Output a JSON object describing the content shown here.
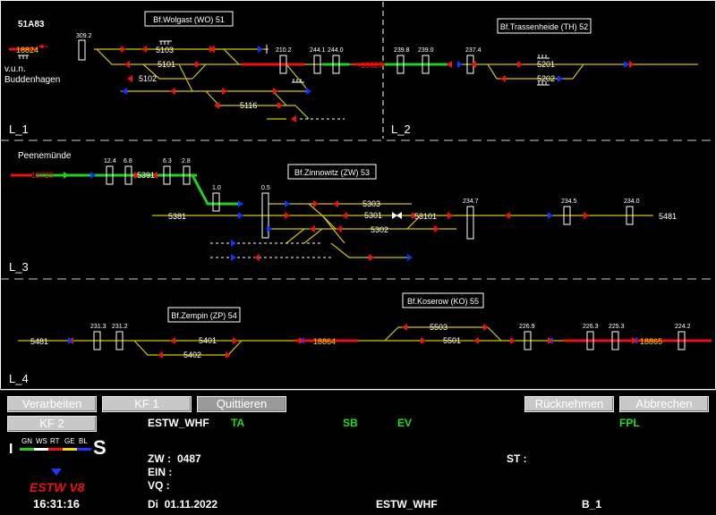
{
  "header": {
    "id": "51A83"
  },
  "stations": {
    "wolgast": "Bf.Wolgast (WO) 51",
    "trassenheide": "Bf.Trassenheide (TH) 52",
    "zinnowitz": "Bf.Zinnowitz (ZW) 53",
    "zempin": "Bf.Zempin (ZP) 54",
    "koserow": "Bf.Koserow (KO) 55"
  },
  "sections": {
    "l1": "L_1",
    "l2": "L_2",
    "l3": "L_3",
    "l4": "L_4"
  },
  "places": {
    "vun": "v.u.n.",
    "buddenhagen": "Buddenhagen",
    "peenemuende": "Peenemünde"
  },
  "trains": {
    "t18824": "18824",
    "t18827": "18827",
    "t18725": "18725",
    "t18864": "18864",
    "t18865": "18865"
  },
  "km": {
    "k309_2": "309.2",
    "k210_2": "210.2",
    "k244_1": "244.1",
    "k244_0": "244.0",
    "k239_8": "239.8",
    "k239_0": "239.0",
    "k237_4": "237.4",
    "k12_4": "12.4",
    "k6_8": "6.8",
    "k6_3": "6.3",
    "k2_8": "2.8",
    "k1_0": "1.0",
    "k0_5": "0.5",
    "k234_7": "234.7",
    "k234_5": "234.5",
    "k234_0": "234.0",
    "k231_3": "231.3",
    "k231_2": "231.2",
    "k226_9": "226.9",
    "k226_3": "226.3",
    "k225_3": "225.3",
    "k224_2": "224.2"
  },
  "signals": {
    "s5103": "5103",
    "s5101": "5101",
    "s5102": "5102",
    "s5116": "5116",
    "s5201": "5201",
    "s5202": "5202",
    "s5391": "5391",
    "s5381": "5381",
    "s5303": "5303",
    "s5301": "5301",
    "s53101": "53101",
    "s5302": "5302",
    "s5481a": "5481",
    "s5481b": "5481",
    "s5401": "5401",
    "s5402": "5402",
    "s5503": "5503",
    "s5501": "5501"
  },
  "buttons": {
    "verarbeiten": "Verarbeiten",
    "kf1": "KF 1",
    "quittieren": "Quittieren",
    "ruecknehmen": "Rücknehmen",
    "abbrechen": "Abbrechen",
    "kf2": "KF 2"
  },
  "status": {
    "estw_whf": "ESTW_WHF",
    "ta": "TA",
    "sb": "SB",
    "ev": "EV",
    "fpl": "FPL",
    "zw_label": "ZW :",
    "zw_value": "0487",
    "ein": "EIN :",
    "vq": "VQ :",
    "st": "ST :",
    "date": "Di  01.11.2022",
    "estw_bottom": "ESTW_WHF",
    "b1": "B_1",
    "time": "16:31:16"
  },
  "legend": {
    "i": "I",
    "s": "S",
    "gn": "GN",
    "ws": "WS",
    "rt": "RT",
    "ge": "GE",
    "bl": "BL",
    "colors": {
      "gn": "#22cc22",
      "ws": "#ffffff",
      "rt": "#ee1111",
      "ge": "#eedd00",
      "bl": "#2233ff"
    },
    "logo": "ESTW V8"
  },
  "colors": {
    "track": "#d4c400",
    "occupied": "#ee1111",
    "route": "#22cc22",
    "signal_red": "#ee1111",
    "signal_blue": "#1133ff"
  }
}
